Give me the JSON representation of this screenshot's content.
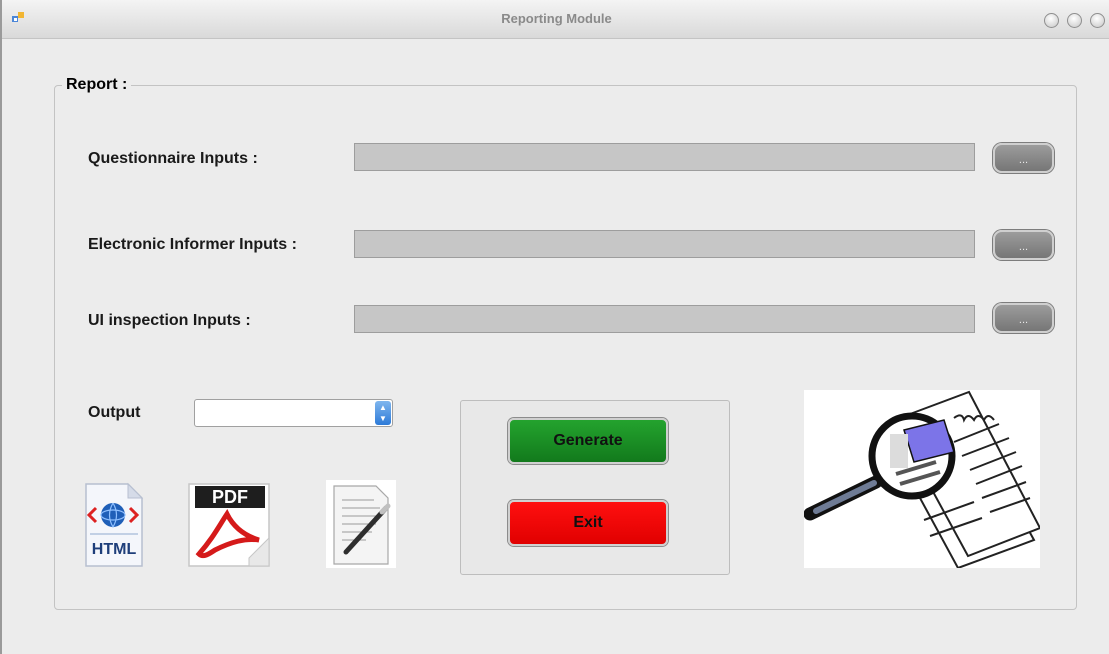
{
  "window": {
    "title": "Reporting Module",
    "icon": "app-icon",
    "controls": [
      "minimize-icon",
      "maximize-icon",
      "close-icon"
    ]
  },
  "report_group": {
    "legend": "Report :"
  },
  "inputs": {
    "questionnaire": {
      "label": "Questionnaire Inputs :",
      "value": "",
      "browse_label": "..."
    },
    "electronic_informer": {
      "label": "Electronic Informer Inputs :",
      "value": "",
      "browse_label": "..."
    },
    "ui_inspection": {
      "label": "UI inspection Inputs :",
      "value": "",
      "browse_label": "..."
    }
  },
  "output": {
    "label": "Output",
    "selected_value": ""
  },
  "formats": {
    "html_icon_text": "HTML",
    "pdf_icon_text": "PDF",
    "icons": [
      "html-icon",
      "pdf-icon",
      "document-edit-icon"
    ]
  },
  "actions": {
    "generate_label": "Generate",
    "exit_label": "Exit"
  },
  "colors": {
    "generate": "#1a8f24",
    "exit": "#f00000",
    "title_text": "#8a8a8a"
  }
}
